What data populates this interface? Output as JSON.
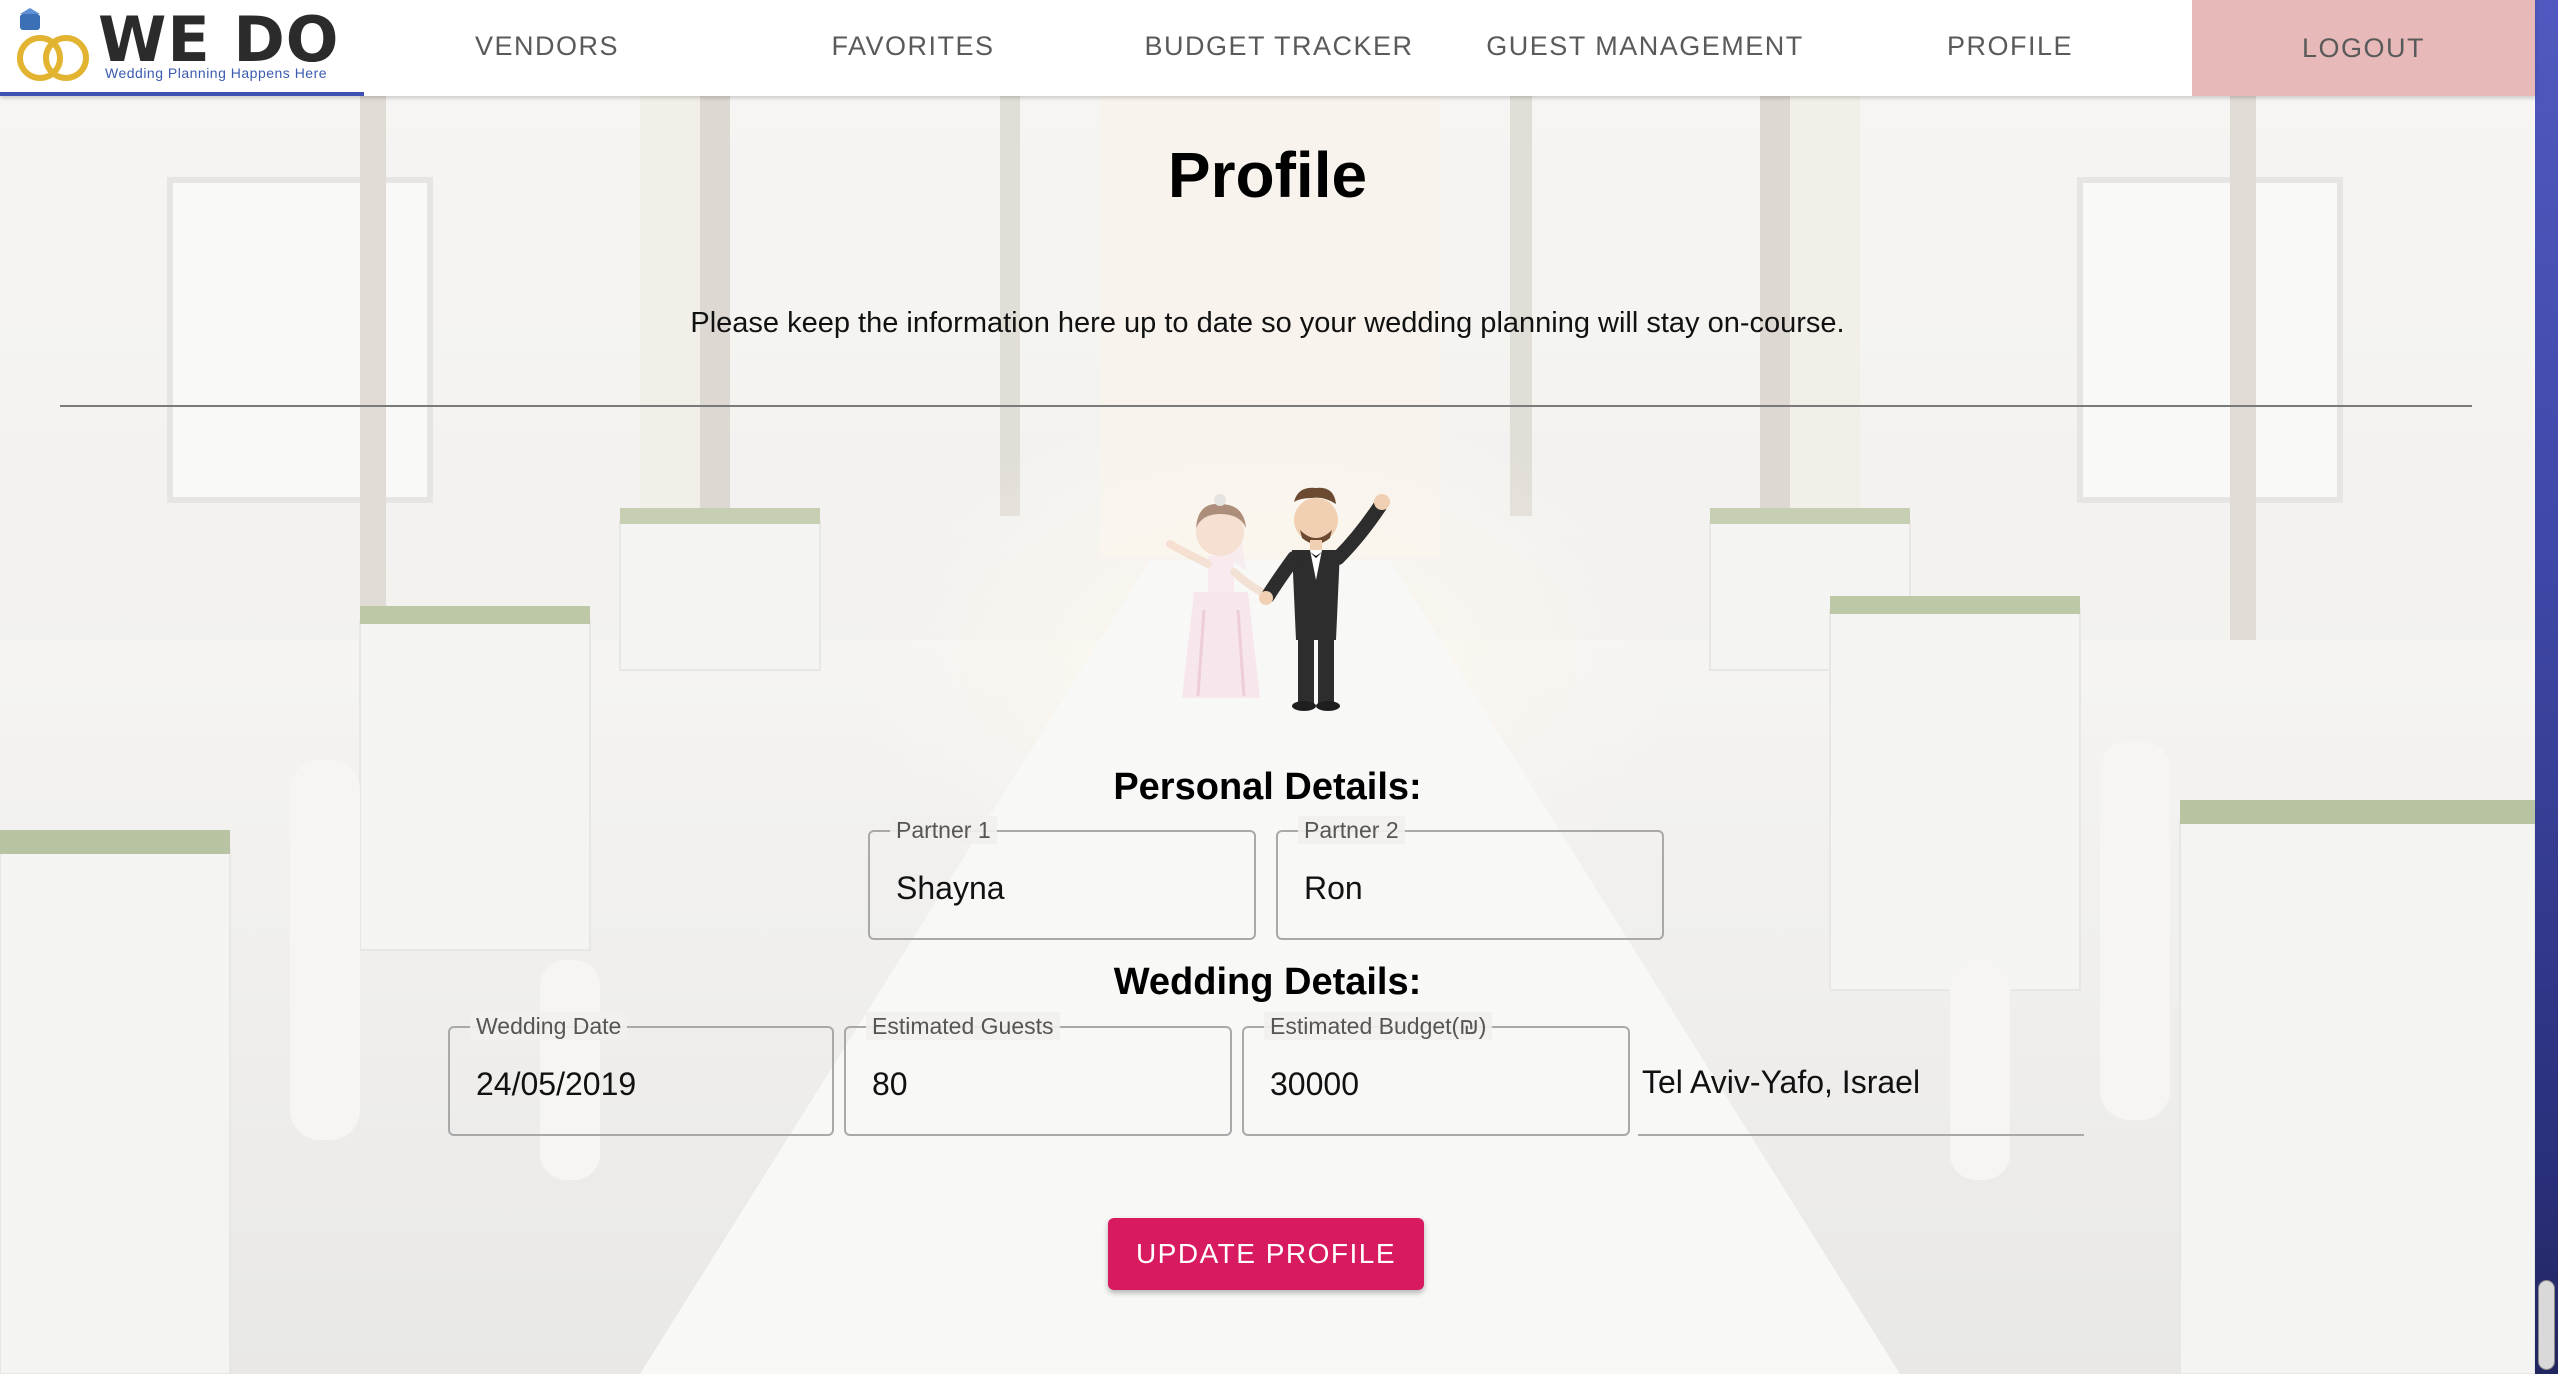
{
  "brand": {
    "name": "WE DO",
    "tagline": "Wedding Planning Happens Here"
  },
  "nav": {
    "items": [
      "VENDORS",
      "FAVORITES",
      "BUDGET TRACKER",
      "GUEST MANAGEMENT",
      "PROFILE"
    ],
    "logout": "LOGOUT"
  },
  "page": {
    "title": "Profile",
    "subtitle": "Please keep the information here up to date so your wedding planning will stay on-course."
  },
  "personal_details": {
    "heading": "Personal Details:",
    "partner1": {
      "label": "Partner 1",
      "value": "Shayna"
    },
    "partner2": {
      "label": "Partner 2",
      "value": "Ron"
    }
  },
  "wedding_details": {
    "heading": "Wedding Details:",
    "date": {
      "label": "Wedding Date",
      "value": "24/05/2019"
    },
    "guests": {
      "label": "Estimated Guests",
      "value": "80"
    },
    "budget": {
      "label": "Estimated Budget(₪)",
      "value": "30000"
    },
    "location": {
      "value": "Tel Aviv-Yafo, Israel"
    }
  },
  "actions": {
    "update_label": "UPDATE PROFILE"
  },
  "colors": {
    "accent": "#d81b60",
    "logout_bg": "#e7b9b9",
    "logo_underline": "#3f51b5"
  },
  "icons": {
    "logo": "wedding-rings-icon",
    "illustration": "bride-and-groom-illustration"
  }
}
